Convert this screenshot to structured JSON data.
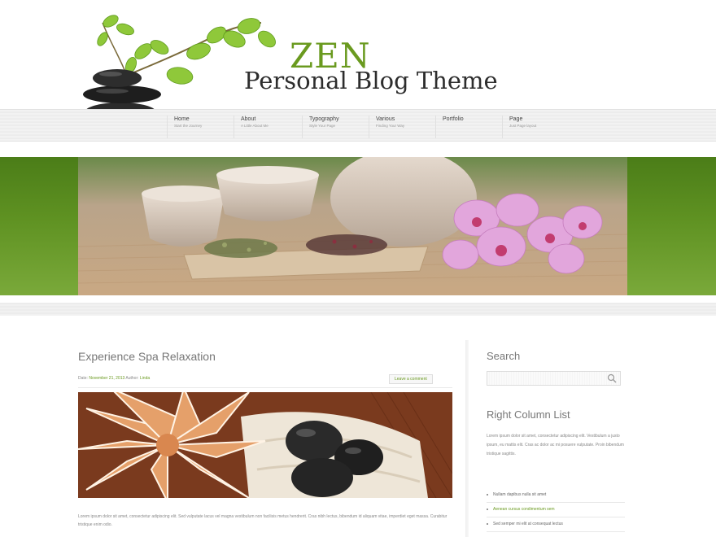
{
  "header": {
    "title": "ZEN",
    "tagline": "Personal Blog Theme"
  },
  "nav": [
    {
      "label": "Home",
      "sub": "Start the Journey"
    },
    {
      "label": "About",
      "sub": "A Little About Me"
    },
    {
      "label": "Typography",
      "sub": "Style Your Page"
    },
    {
      "label": "Various",
      "sub": "Finding Your Way"
    },
    {
      "label": "Portfolio",
      "sub": ""
    },
    {
      "label": "Page",
      "sub": "Just Page layout"
    }
  ],
  "post": {
    "title": "Experience Spa Relaxation",
    "meta_prefix": "Date: ",
    "date": "November 21, 2013",
    "author_prefix": " Author: ",
    "author": "Linda",
    "comments": "Leave a comment",
    "excerpt": "Lorem ipsum dolor sit amet, consectetur adipiscing elit. Sed vulputate lacus vel magna vestibulum non facilisis metus hendrerit. Cras nibh lectus, bibendum id aliquam vitae, imperdiet eget massa. Curabitur tristique enim odio."
  },
  "sidebar": {
    "search_heading": "Search",
    "list_heading": "Right Column List",
    "text": "Lorem ipsum dolor sit amet, consectetur adipiscing elit. Vestibulum a justo ipsum, eu mattis elit. Cras ac dolor ac mi posuere vulputate. Proin bibendum tristique sagittis.",
    "items": [
      "Nullam dapibus nulla sit amet",
      "Aenean cursus condimentum sem",
      "Sed semper mi elit at consequat lectus"
    ]
  },
  "colors": {
    "accent": "#6a9a1f",
    "band_green": "#5f9222"
  }
}
